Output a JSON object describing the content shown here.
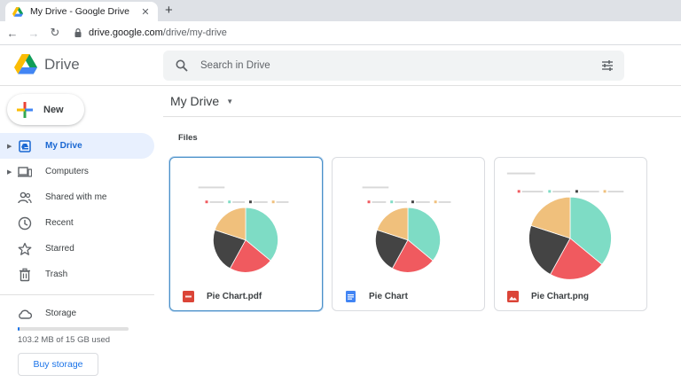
{
  "browser": {
    "tab_title": "My Drive - Google Drive",
    "close_glyph": "✕",
    "new_tab_glyph": "+",
    "url_host": "drive.google.com",
    "url_path": "/drive/my-drive"
  },
  "header": {
    "brand": "Drive",
    "search_placeholder": "Search in Drive"
  },
  "sidebar": {
    "new_label": "New",
    "items": [
      {
        "label": "My Drive",
        "icon": "my-drive-icon",
        "active": true,
        "expandable": true
      },
      {
        "label": "Computers",
        "icon": "computers-icon",
        "active": false,
        "expandable": true
      },
      {
        "label": "Shared with me",
        "icon": "shared-icon",
        "active": false
      },
      {
        "label": "Recent",
        "icon": "clock-icon",
        "active": false
      },
      {
        "label": "Starred",
        "icon": "star-icon",
        "active": false
      },
      {
        "label": "Trash",
        "icon": "trash-icon",
        "active": false
      }
    ],
    "storage_label": "Storage",
    "usage_text": "103.2 MB of 15 GB used",
    "usage_fraction": 0.0067,
    "buy_label": "Buy storage"
  },
  "main": {
    "title": "My Drive",
    "section": "Files",
    "files": [
      {
        "name": "Pie Chart.pdf",
        "type": "pdf",
        "icon": "pdf-icon",
        "selected": true
      },
      {
        "name": "Pie Chart",
        "type": "doc",
        "icon": "docs-icon",
        "selected": false
      },
      {
        "name": "Pie Chart.png",
        "type": "image",
        "icon": "image-icon",
        "selected": false
      }
    ]
  },
  "colors": {
    "accent": "#1a73e8",
    "pie": [
      "#7edcc5",
      "#f05a5f",
      "#444444",
      "#f0c07c"
    ],
    "pdf": "#db4437",
    "doc": "#4285f4"
  }
}
